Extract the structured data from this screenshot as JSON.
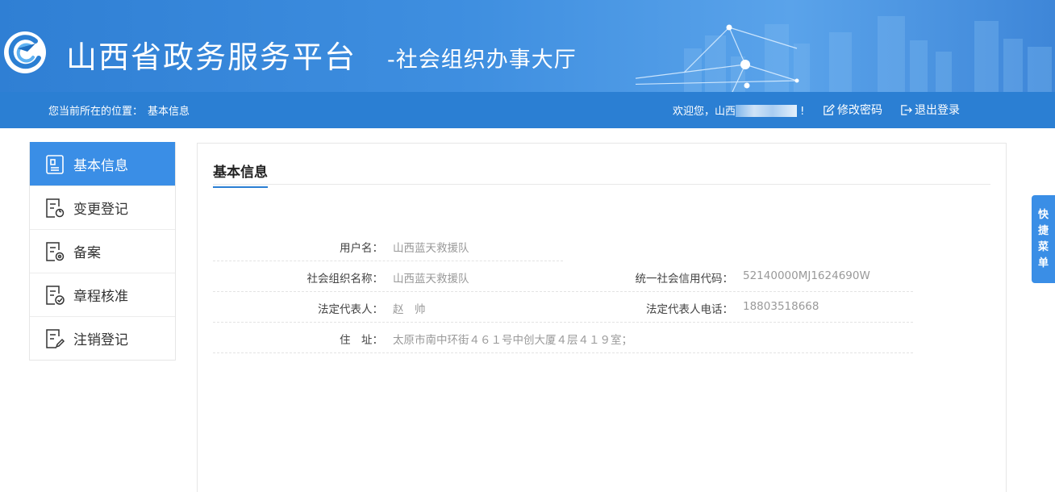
{
  "header": {
    "title": "山西省政务服务平台",
    "subtitle": "-社会组织办事大厅"
  },
  "navbar": {
    "location_label": "您当前所在的位置：",
    "location_value": "基本信息",
    "welcome": "欢迎您，山西",
    "change_password": "修改密码",
    "logout": "退出登录"
  },
  "sidebar": {
    "items": [
      {
        "label": "基本信息",
        "icon": "profile-icon",
        "active": true
      },
      {
        "label": "变更登记",
        "icon": "document-refresh-icon",
        "active": false
      },
      {
        "label": "备案",
        "icon": "document-settings-icon",
        "active": false
      },
      {
        "label": "章程核准",
        "icon": "document-check-icon",
        "active": false
      },
      {
        "label": "注销登记",
        "icon": "document-edit-icon",
        "active": false
      }
    ]
  },
  "panel": {
    "title": "基本信息",
    "fields": {
      "username": {
        "label": "用户名：",
        "value": "山西蓝天救援队"
      },
      "org_name": {
        "label": "社会组织名称：",
        "value": "山西蓝天救援队"
      },
      "credit_code": {
        "label": "统一社会信用代码：",
        "value": "52140000MJ1624690W"
      },
      "legal_rep": {
        "label": "法定代表人：",
        "value": "赵　帅"
      },
      "legal_phone": {
        "label": "法定代表人电话：",
        "value": "18803518668"
      },
      "address": {
        "label": "住　址：",
        "value": "太原市南中环街４６１号中创大厦４层４１９室；"
      }
    }
  },
  "quick_menu": {
    "label": "快捷菜单"
  },
  "colors": {
    "primary": "#2b7fd3",
    "active_item": "#3a8ee6",
    "value_text": "#999999"
  }
}
